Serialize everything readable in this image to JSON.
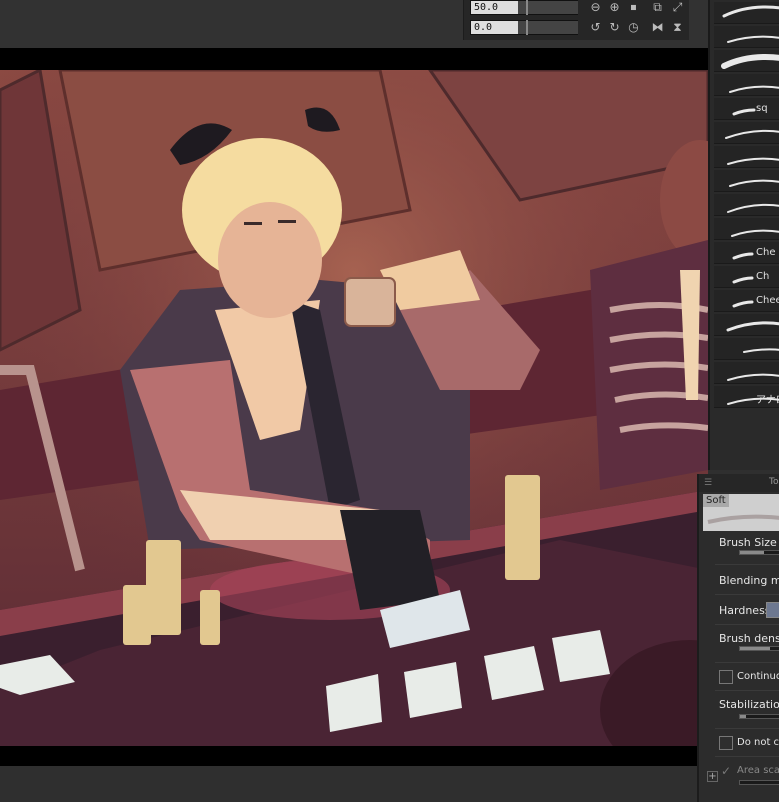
{
  "navigator": {
    "zoom_value": "50.0",
    "rotation_value": "0.0",
    "icons_row1": [
      "zoom-out-icon",
      "zoom-in-icon",
      "stop-icon",
      "fit-icon",
      "fullscreen-icon"
    ],
    "icons_row2": [
      "rotate-left-icon",
      "rotate-right-icon",
      "reset-rotation-icon",
      "flip-horizontal-icon",
      "flip-vertical-icon"
    ]
  },
  "brush_list": {
    "items": [
      {
        "label": ""
      },
      {
        "label": ""
      },
      {
        "label": ""
      },
      {
        "label": ""
      },
      {
        "label": "sq"
      },
      {
        "label": ""
      },
      {
        "label": ""
      },
      {
        "label": ""
      },
      {
        "label": ""
      },
      {
        "label": ""
      },
      {
        "label": "Che"
      },
      {
        "label": "Ch"
      },
      {
        "label": "Chee"
      },
      {
        "label": ""
      },
      {
        "label": ""
      },
      {
        "label": ""
      },
      {
        "label": "アナログ"
      }
    ]
  },
  "tool_property": {
    "title": "To",
    "preview_label": "Soft",
    "brush_size_label": "Brush Size",
    "blending_mode_label": "Blending mod",
    "hardness_label": "Hardness",
    "brush_density_label": "Brush density",
    "continuous_label": "Continuou",
    "stabilization_label": "Stabilization",
    "do_not_cross_label": "Do not cros",
    "area_scale_label": "Area scal"
  },
  "colors": {
    "panel_bg": "#2c2c2c",
    "canvas_border": "#000000",
    "hardness_swatch": "#6d7890",
    "table_felt": "#3a1f2e"
  }
}
